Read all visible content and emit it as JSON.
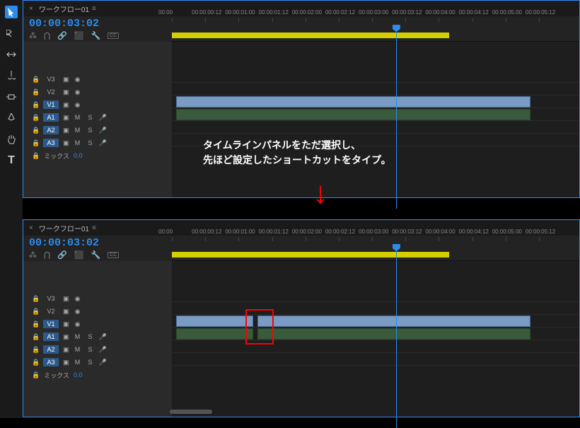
{
  "toolbar": {
    "tools": [
      "select",
      "track-select-forward",
      "ripple-edit",
      "razor",
      "slip",
      "pen",
      "hand",
      "type"
    ]
  },
  "panel": {
    "tab_name": "ワークフロー01",
    "timecode": "00:00:03:02"
  },
  "ruler": {
    "marks": [
      "00:00",
      "00:00:00:12",
      "00:00:01:00",
      "00:00:01:12",
      "00:00:02:00",
      "00:00:02:12",
      "00:00:03:00",
      "00:00:03:12",
      "00:00:04:00",
      "00:00:04:12",
      "00:00:05:00",
      "00:00:05:12"
    ]
  },
  "tracks": {
    "video": [
      {
        "name": "V3",
        "active": false
      },
      {
        "name": "V2",
        "active": false
      },
      {
        "name": "V1",
        "active": true
      }
    ],
    "audio": [
      {
        "name": "A1",
        "active": true,
        "m": "M",
        "s": "S"
      },
      {
        "name": "A2",
        "active": true,
        "m": "M",
        "s": "S"
      },
      {
        "name": "A3",
        "active": true,
        "m": "M",
        "s": "S"
      }
    ],
    "mix_label": "ミックス",
    "mix_value": "0.0"
  },
  "annotation": {
    "line1": "タイムラインパネルをただ選択し、",
    "line2": "先ほど設定したショートカットをタイプ。"
  }
}
